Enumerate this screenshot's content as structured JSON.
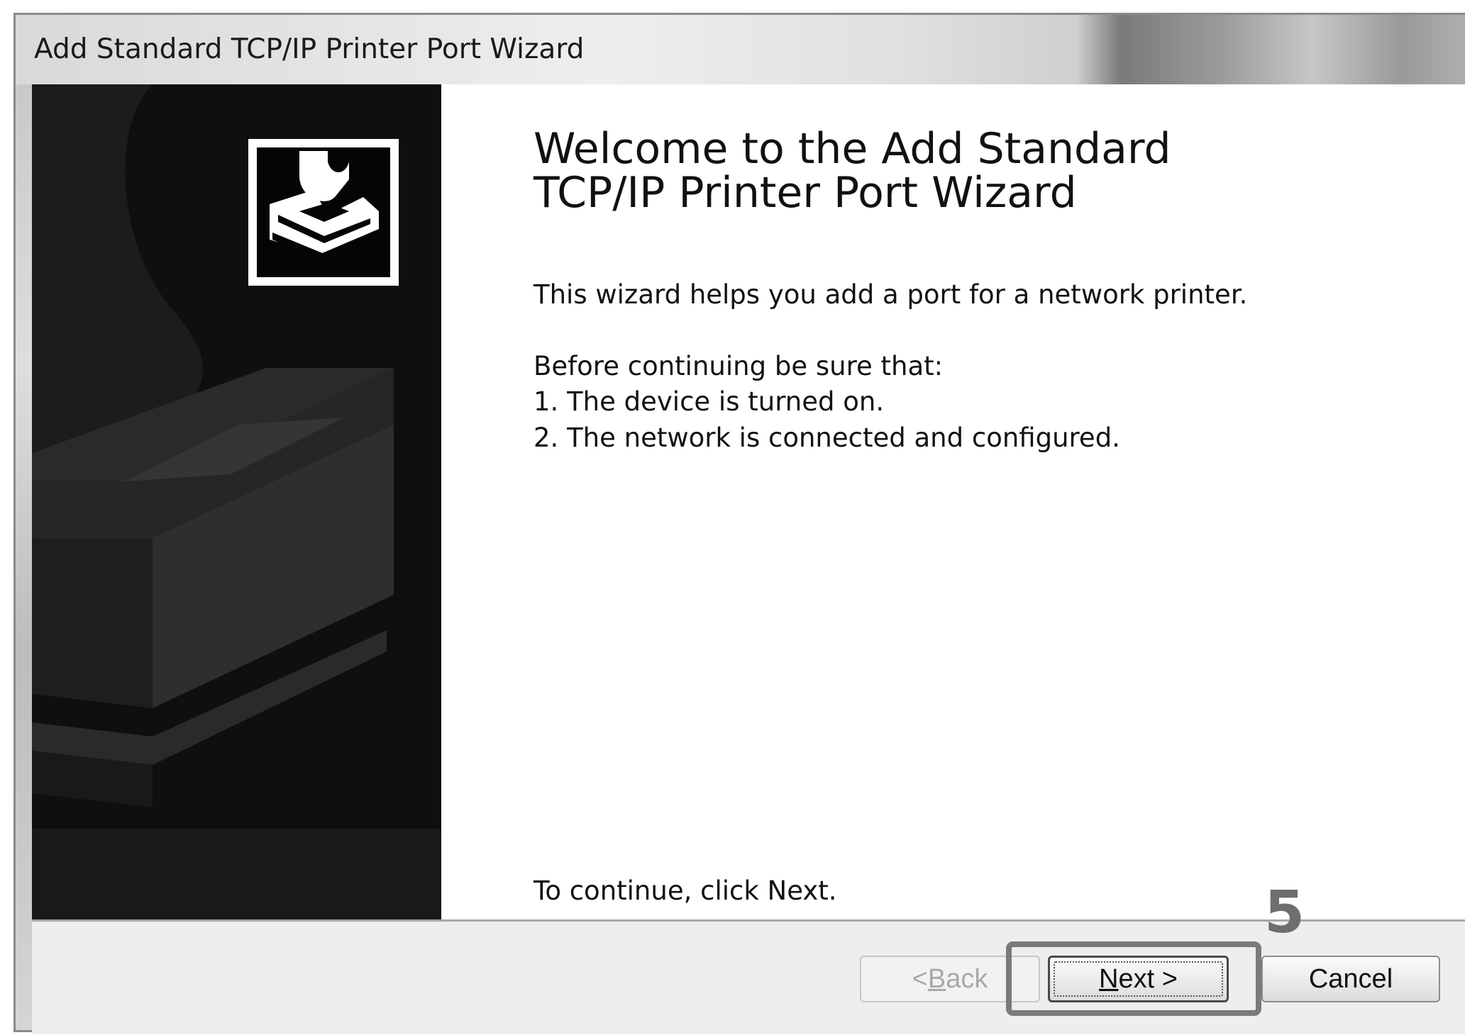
{
  "window": {
    "title": "Add Standard TCP/IP Printer Port Wizard"
  },
  "sidebar": {
    "icon": "printer-wizard-icon"
  },
  "main": {
    "heading_line1": "Welcome to the Add Standard",
    "heading_line2": "TCP/IP Printer Port Wizard",
    "intro": "This wizard helps you add a port for a network printer.",
    "before_label": "Before continuing be sure that:",
    "items": [
      "1.  The device is turned on.",
      "2.  The network is connected and configured."
    ],
    "continue_text": "To continue, click Next."
  },
  "buttons": {
    "back": {
      "prefix": "< ",
      "mnemonic": "B",
      "rest": "ack",
      "enabled": false
    },
    "next": {
      "mnemonic": "N",
      "rest": "ext >",
      "enabled": true
    },
    "cancel": {
      "label": "Cancel",
      "enabled": true
    }
  },
  "annotation": {
    "step_number": "5"
  },
  "colors": {
    "sidebar_bg": "#0f0f0f",
    "content_bg": "#ffffff",
    "footer_bg": "#eeeeee",
    "highlight": "#7a7a7a"
  }
}
